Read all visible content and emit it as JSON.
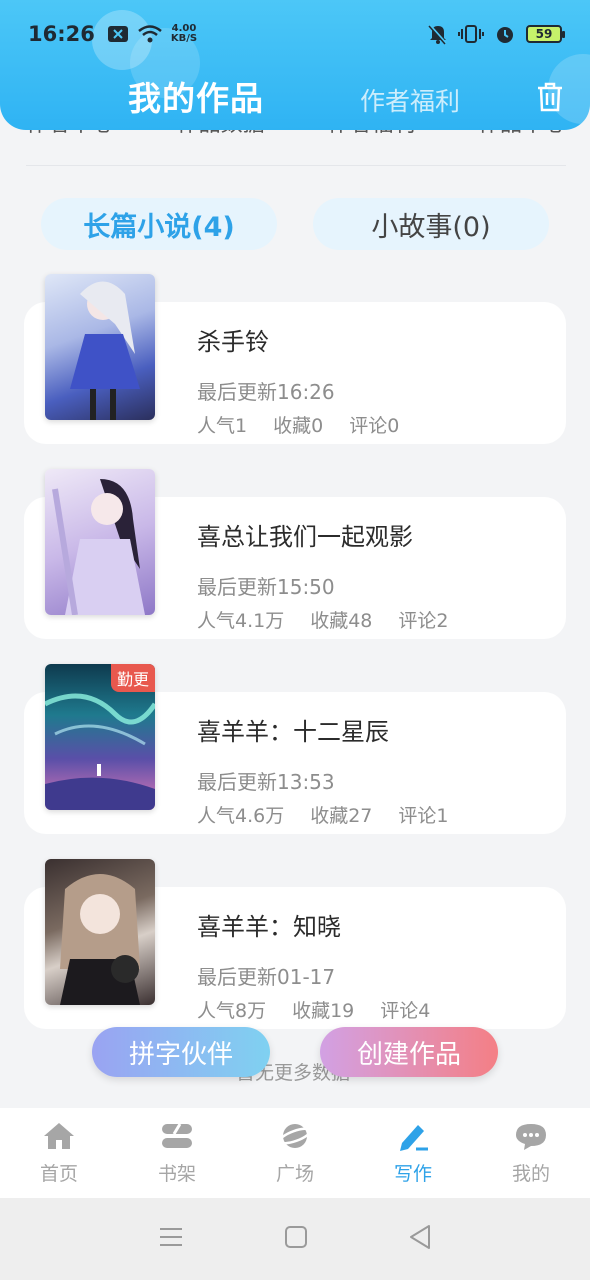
{
  "status_bar": {
    "time": "16:26",
    "net_speed_value": "4.00",
    "net_speed_unit": "KB/S",
    "battery": "59",
    "icons": [
      "notification-x-icon",
      "wifi-icon",
      "silent-bell-icon",
      "vibrate-icon",
      "alarm-icon",
      "battery-icon"
    ]
  },
  "header": {
    "title": "我的作品",
    "tab_secondary": "作者福利",
    "trash_icon": "trash-icon"
  },
  "scrolled_menu": {
    "items": [
      "作者中心",
      "作品数据",
      "作者福利",
      "作品中心"
    ]
  },
  "segments": [
    {
      "label": "长篇小说(4)",
      "active": true
    },
    {
      "label": "小故事(0)",
      "active": false
    }
  ],
  "books": [
    {
      "title": "杀手铃",
      "updated": "最后更新16:26",
      "popularity": "人气1",
      "favorites": "收藏0",
      "comments": "评论0",
      "badge": ""
    },
    {
      "title": "喜总让我们一起观影",
      "updated": "最后更新15:50",
      "popularity": "人气4.1万",
      "favorites": "收藏48",
      "comments": "评论2",
      "badge": ""
    },
    {
      "title": "喜羊羊：十二星辰",
      "updated": "最后更新13:53",
      "popularity": "人气4.6万",
      "favorites": "收藏27",
      "comments": "评论1",
      "badge": "勤更"
    },
    {
      "title": "喜羊羊：知晓",
      "updated": "最后更新01-17",
      "popularity": "人气8万",
      "favorites": "收藏19",
      "comments": "评论4",
      "badge": ""
    }
  ],
  "floating_buttons": {
    "partner": "拼字伙伴",
    "create": "创建作品"
  },
  "load_more": "暂无更多数据",
  "bottom_nav": [
    {
      "label": "首页",
      "icon": "home-icon",
      "active": false
    },
    {
      "label": "书架",
      "icon": "bookshelf-icon",
      "active": false
    },
    {
      "label": "广场",
      "icon": "planet-icon",
      "active": false
    },
    {
      "label": "写作",
      "icon": "pen-icon",
      "active": true
    },
    {
      "label": "我的",
      "icon": "chat-bubble-icon",
      "active": false
    }
  ],
  "colors": {
    "accent": "#2ea2e8",
    "header": "#3dbdf5",
    "badge": "#e8584e",
    "partner_gradient": [
      "#8fa8f4",
      "#7cd0f0"
    ],
    "create_gradient": [
      "#d59fe0",
      "#f47f85"
    ]
  }
}
